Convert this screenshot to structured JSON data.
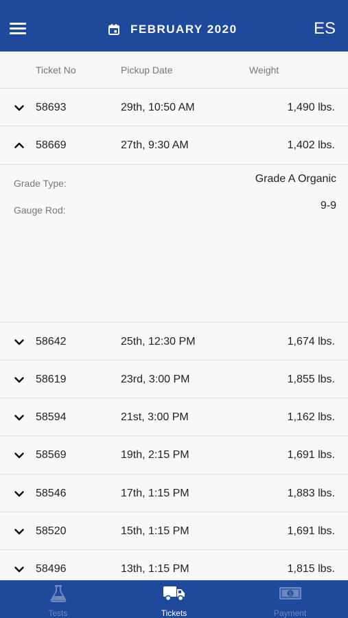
{
  "header": {
    "month_label": "FEBRUARY 2020",
    "language": "ES",
    "bg_color": "#1f4a9c"
  },
  "columns": {
    "ticket": "Ticket No",
    "pickup": "Pickup Date",
    "weight": "Weight"
  },
  "tickets": [
    {
      "ticket": "58693",
      "pickup": "29th, 10:50 AM",
      "weight": "1,490 lbs.",
      "expanded": false
    },
    {
      "ticket": "58669",
      "pickup": "27th, 9:30 AM",
      "weight": "1,402 lbs.",
      "expanded": true
    },
    {
      "ticket": "58642",
      "pickup": "25th, 12:30 PM",
      "weight": "1,674 lbs.",
      "expanded": false
    },
    {
      "ticket": "58619",
      "pickup": "23rd, 3:00 PM",
      "weight": "1,855 lbs.",
      "expanded": false
    },
    {
      "ticket": "58594",
      "pickup": "21st, 3:00 PM",
      "weight": "1,162 lbs.",
      "expanded": false
    },
    {
      "ticket": "58569",
      "pickup": "19th, 2:15 PM",
      "weight": "1,691 lbs.",
      "expanded": false
    },
    {
      "ticket": "58546",
      "pickup": "17th, 1:15 PM",
      "weight": "1,883 lbs.",
      "expanded": false
    },
    {
      "ticket": "58520",
      "pickup": "15th, 1:15 PM",
      "weight": "1,691 lbs.",
      "expanded": false
    },
    {
      "ticket": "58496",
      "pickup": "13th, 1:15 PM",
      "weight": "1,815 lbs.",
      "expanded": false
    }
  ],
  "detail": {
    "grade_type_label": "Grade Type:",
    "grade_type_value": "Grade A Organic",
    "gauge_rod_label": "Gauge Rod:",
    "gauge_rod_value": "9-9"
  },
  "tabs": [
    {
      "label": "Tests",
      "icon": "flask-icon",
      "active": false
    },
    {
      "label": "Tickets",
      "icon": "truck-icon",
      "active": true
    },
    {
      "label": "Payment",
      "icon": "banknote-icon",
      "active": false
    }
  ]
}
